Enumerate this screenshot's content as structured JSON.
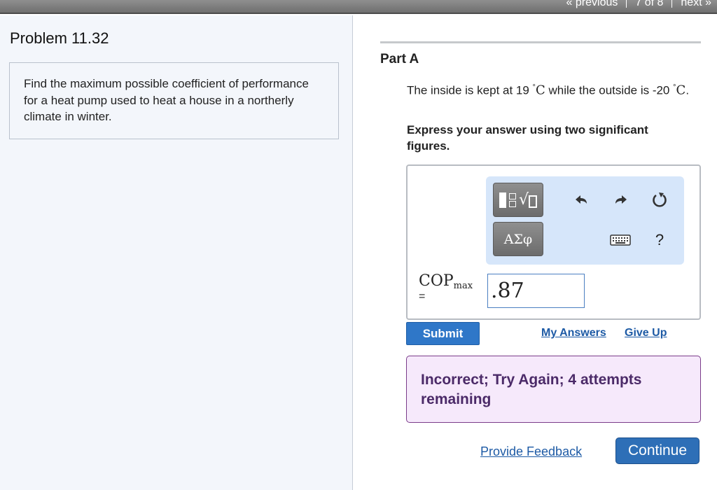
{
  "topnav": {
    "previous": "« previous",
    "position": "7 of 8",
    "next": "next »"
  },
  "problem": {
    "title": "Problem 11.32",
    "text": "Find the maximum possible coefficient of performance for a heat pump used to heat a house in a northerly climate in winter."
  },
  "part": {
    "title": "Part A",
    "question": {
      "before_inside": "The inside is kept at 19 ",
      "inside_unit": "C",
      "middle": " while the outside is -20 ",
      "outside_unit": "C",
      "end": ".",
      "degree": "°"
    },
    "instructions": "Express your answer using two significant figures.",
    "answer": {
      "variable": "COP",
      "subscript": "max",
      "equals": "=",
      "value": ".87"
    },
    "toolbar": {
      "symbols_label": "ΑΣφ",
      "help_label": "?",
      "icons": [
        "templates-icon",
        "undo-icon",
        "redo-icon",
        "reset-icon",
        "keyboard-icon",
        "help-icon"
      ]
    }
  },
  "actions": {
    "submit": "Submit",
    "my_answers": "My Answers",
    "give_up": "Give Up"
  },
  "feedback": {
    "message": "Incorrect; Try Again; 4 attempts remaining"
  },
  "footer": {
    "provide_feedback": "Provide Feedback",
    "continue": "Continue"
  },
  "colors": {
    "primary_button": "#2f77c8",
    "link": "#1d5aa5",
    "feedback_bg": "#f6e9fb",
    "feedback_border": "#7a3c8a",
    "toolbar_bg": "#d6e6fa",
    "left_pane_bg": "#f3f6fb"
  }
}
